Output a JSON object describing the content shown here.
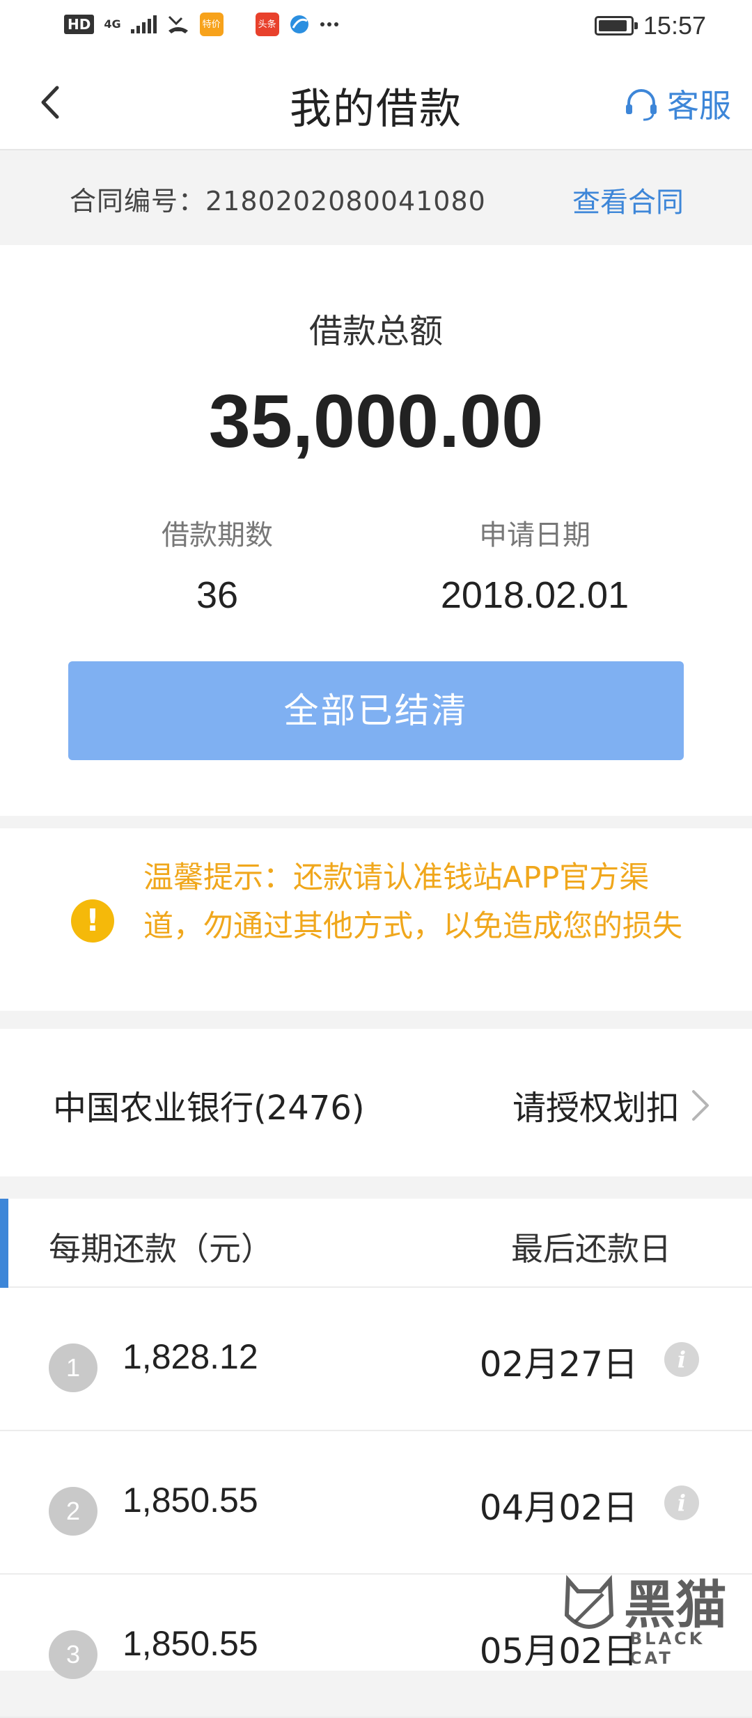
{
  "status_bar": {
    "hd": "HD",
    "network": "4G",
    "app_badges": [
      {
        "label": "特价",
        "color": "#f7a21b"
      },
      {
        "label": "头条",
        "color": "#e8412c"
      }
    ],
    "time": "15:57",
    "battery_level": 0.9
  },
  "nav": {
    "title": "我的借款",
    "service_label": "客服"
  },
  "contract": {
    "label": "合同编号：2180202080041080",
    "link": "查看合同"
  },
  "loan": {
    "total_label": "借款总额",
    "total_amount": "35,000.00",
    "terms_label": "借款期数",
    "terms_value": "36",
    "date_label": "申请日期",
    "date_value": "2018.02.01",
    "status_button": "全部已结清"
  },
  "notice": {
    "text": "温馨提示：还款请认准钱站APP官方渠道，勿通过其他方式，以免造成您的损失"
  },
  "bank": {
    "name": "中国农业银行(2476)",
    "action": "请授权划扣"
  },
  "schedule": {
    "col_amount": "每期还款（元）",
    "col_due": "最后还款日",
    "rows": [
      {
        "index": "1",
        "amount": "1,828.12",
        "due": "02月27日"
      },
      {
        "index": "2",
        "amount": "1,850.55",
        "due": "04月02日"
      },
      {
        "index": "3",
        "amount": "1,850.55",
        "due": "05月02日"
      }
    ]
  },
  "watermark": {
    "cn": "黑猫",
    "en": "BLACK CAT"
  },
  "colors": {
    "accent": "#3d86d8",
    "button": "#7fb0f2",
    "notice": "#f0a71c",
    "warning_icon": "#f5b90a"
  }
}
